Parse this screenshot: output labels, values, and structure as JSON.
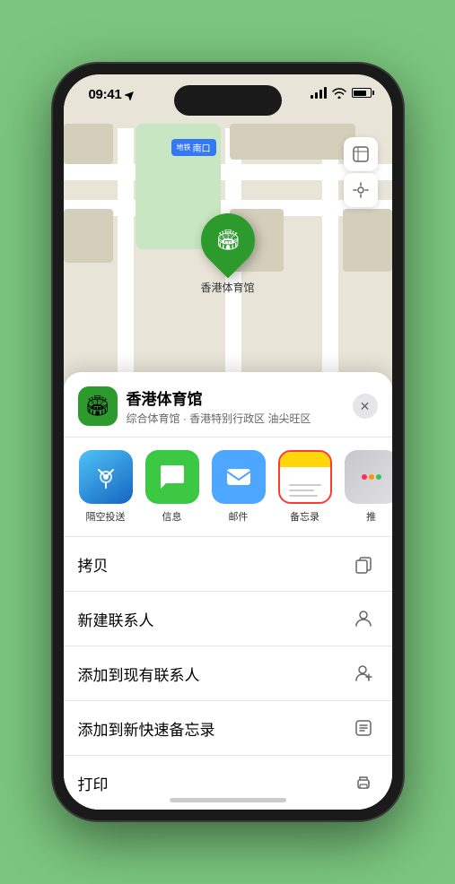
{
  "status_bar": {
    "time": "09:41",
    "time_icon": "location-arrow-icon"
  },
  "map": {
    "label_tag": "南口",
    "location_name": "香港体育馆"
  },
  "venue": {
    "name": "香港体育馆",
    "subtitle": "综合体育馆 · 香港特别行政区 油尖旺区",
    "icon_emoji": "🏟️"
  },
  "share_items": [
    {
      "id": "airdrop",
      "label": "隔空投送",
      "bg_class": "share-icon-airdrop"
    },
    {
      "id": "messages",
      "label": "信息",
      "bg_class": "share-icon-messages"
    },
    {
      "id": "mail",
      "label": "邮件",
      "bg_class": "share-icon-mail"
    },
    {
      "id": "notes",
      "label": "备忘录",
      "bg_class": "share-icon-notes",
      "selected": true
    },
    {
      "id": "more",
      "label": "推",
      "bg_class": "share-icon-more"
    }
  ],
  "actions": [
    {
      "id": "copy",
      "label": "拷贝",
      "icon": "copy-icon"
    },
    {
      "id": "new-contact",
      "label": "新建联系人",
      "icon": "person-icon"
    },
    {
      "id": "add-existing",
      "label": "添加到现有联系人",
      "icon": "person-plus-icon"
    },
    {
      "id": "add-notes",
      "label": "添加到新快速备忘录",
      "icon": "notes-icon"
    },
    {
      "id": "print",
      "label": "打印",
      "icon": "printer-icon"
    }
  ],
  "map_controls": {
    "map_btn_icon": "map-icon",
    "location_btn_icon": "location-icon"
  }
}
